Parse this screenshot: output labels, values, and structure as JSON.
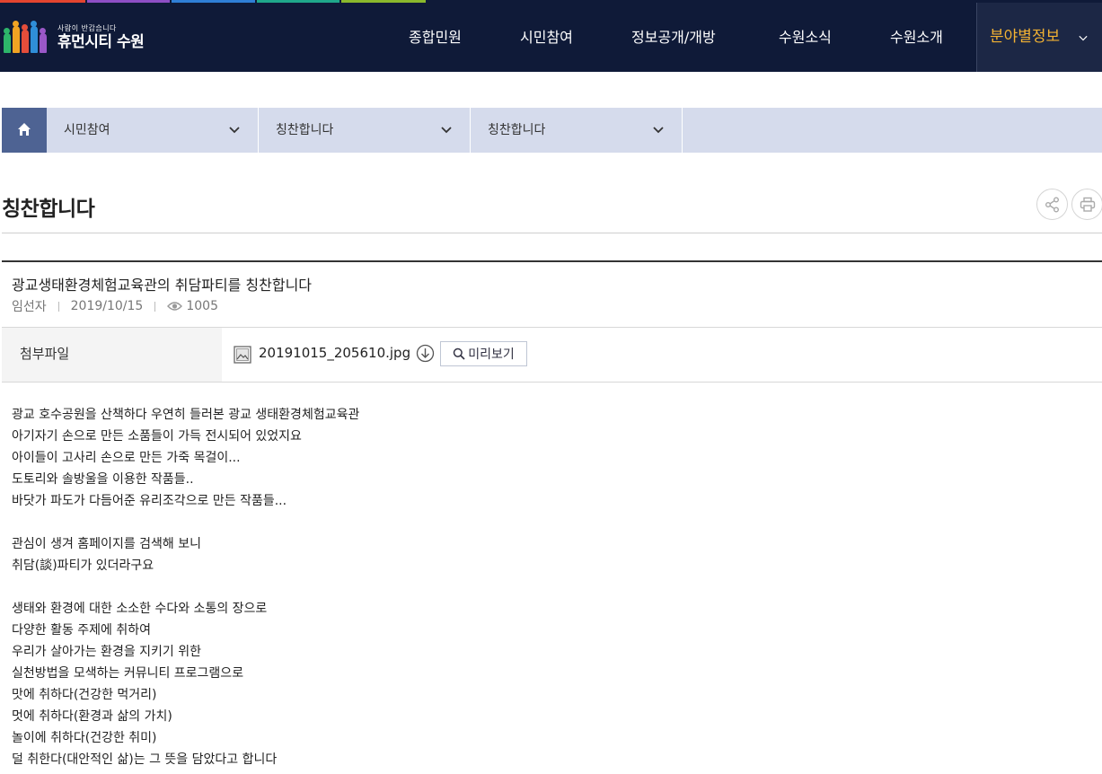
{
  "header": {
    "logo_sub": "사람이 반갑습니다",
    "logo_main": "휴먼시티 수원",
    "nav": [
      "종합민원",
      "시민참여",
      "정보공개/개방",
      "수원소식",
      "수원소개"
    ],
    "active_nav": "분야별정보",
    "colors": {
      "bg": "#0f1a38",
      "active": "#f2b233"
    }
  },
  "location": {
    "home_icon": "home-icon",
    "items": [
      "시민참여",
      "칭찬합니다",
      "칭찬합니다"
    ]
  },
  "page": {
    "title": "칭찬합니다",
    "share_icon": "share-icon",
    "print_icon": "print-icon"
  },
  "post": {
    "title": "광교생태환경체험교육관의 취담파티를 칭찬합니다",
    "author": "임선자",
    "date": "2019/10/15",
    "views": "1005",
    "attachment_label": "첨부파일",
    "file_name": "20191015_205610.jpg",
    "preview_label": "미리보기",
    "body": [
      "광교 호수공원을 산책하다 우연히 들러본 광교 생태환경체험교육관",
      "아기자기 손으로 만든 소품들이 가득 전시되어 있었지요",
      "아이들이 고사리 손으로 만든 가죽 목걸이...",
      "도토리와 솔방울을 이용한 작품들..",
      "바닷가 파도가 다듬어준 유리조각으로 만든 작품들...",
      "",
      "관심이 생겨 홈페이지를 검색해 보니",
      "취담(談)파티가 있더라구요",
      "",
      "생태와 환경에 대한 소소한 수다와 소통의 장으로",
      "다양한 활동 주제에 취하여",
      "우리가 살아가는 환경을 지키기 위한",
      "실천방법을 모색하는 커뮤니티 프로그램으로",
      "맛에 취하다(건강한 먹거리)",
      "멋에 취하다(환경과 삶의 가치)",
      "놀이에 취하다(건강한 취미)",
      "덜 취한다(대안적인 삶)는 그 뜻을 담았다고 합니다"
    ]
  }
}
